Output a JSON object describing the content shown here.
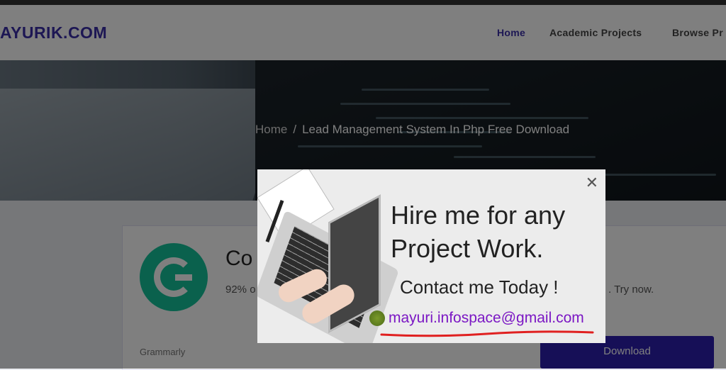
{
  "header": {
    "logo": "AYURIK.COM",
    "nav": [
      "Home",
      "Academic Projects",
      "Browse Pr"
    ]
  },
  "hero": {
    "breadcrumb_home": "Home",
    "breadcrumb_sep": "/",
    "breadcrumb_current": "Lead Management System In Php Free Download"
  },
  "ad": {
    "title": "Co",
    "text": "92% o",
    "text2": ". Try now.",
    "brand": "Grammarly",
    "button": "Download"
  },
  "popup": {
    "close": "✕",
    "line1": "Hire me for any",
    "line2": "Project Work.",
    "line3": "Contact me Today !",
    "email": "mayuri.infospace@gmail.com"
  },
  "colors": {
    "brand": "#3a2fa8",
    "download_button": "#2d1fae",
    "grammarly_green": "#15c39a",
    "email": "#7b17c4",
    "underline": "#e02020"
  }
}
